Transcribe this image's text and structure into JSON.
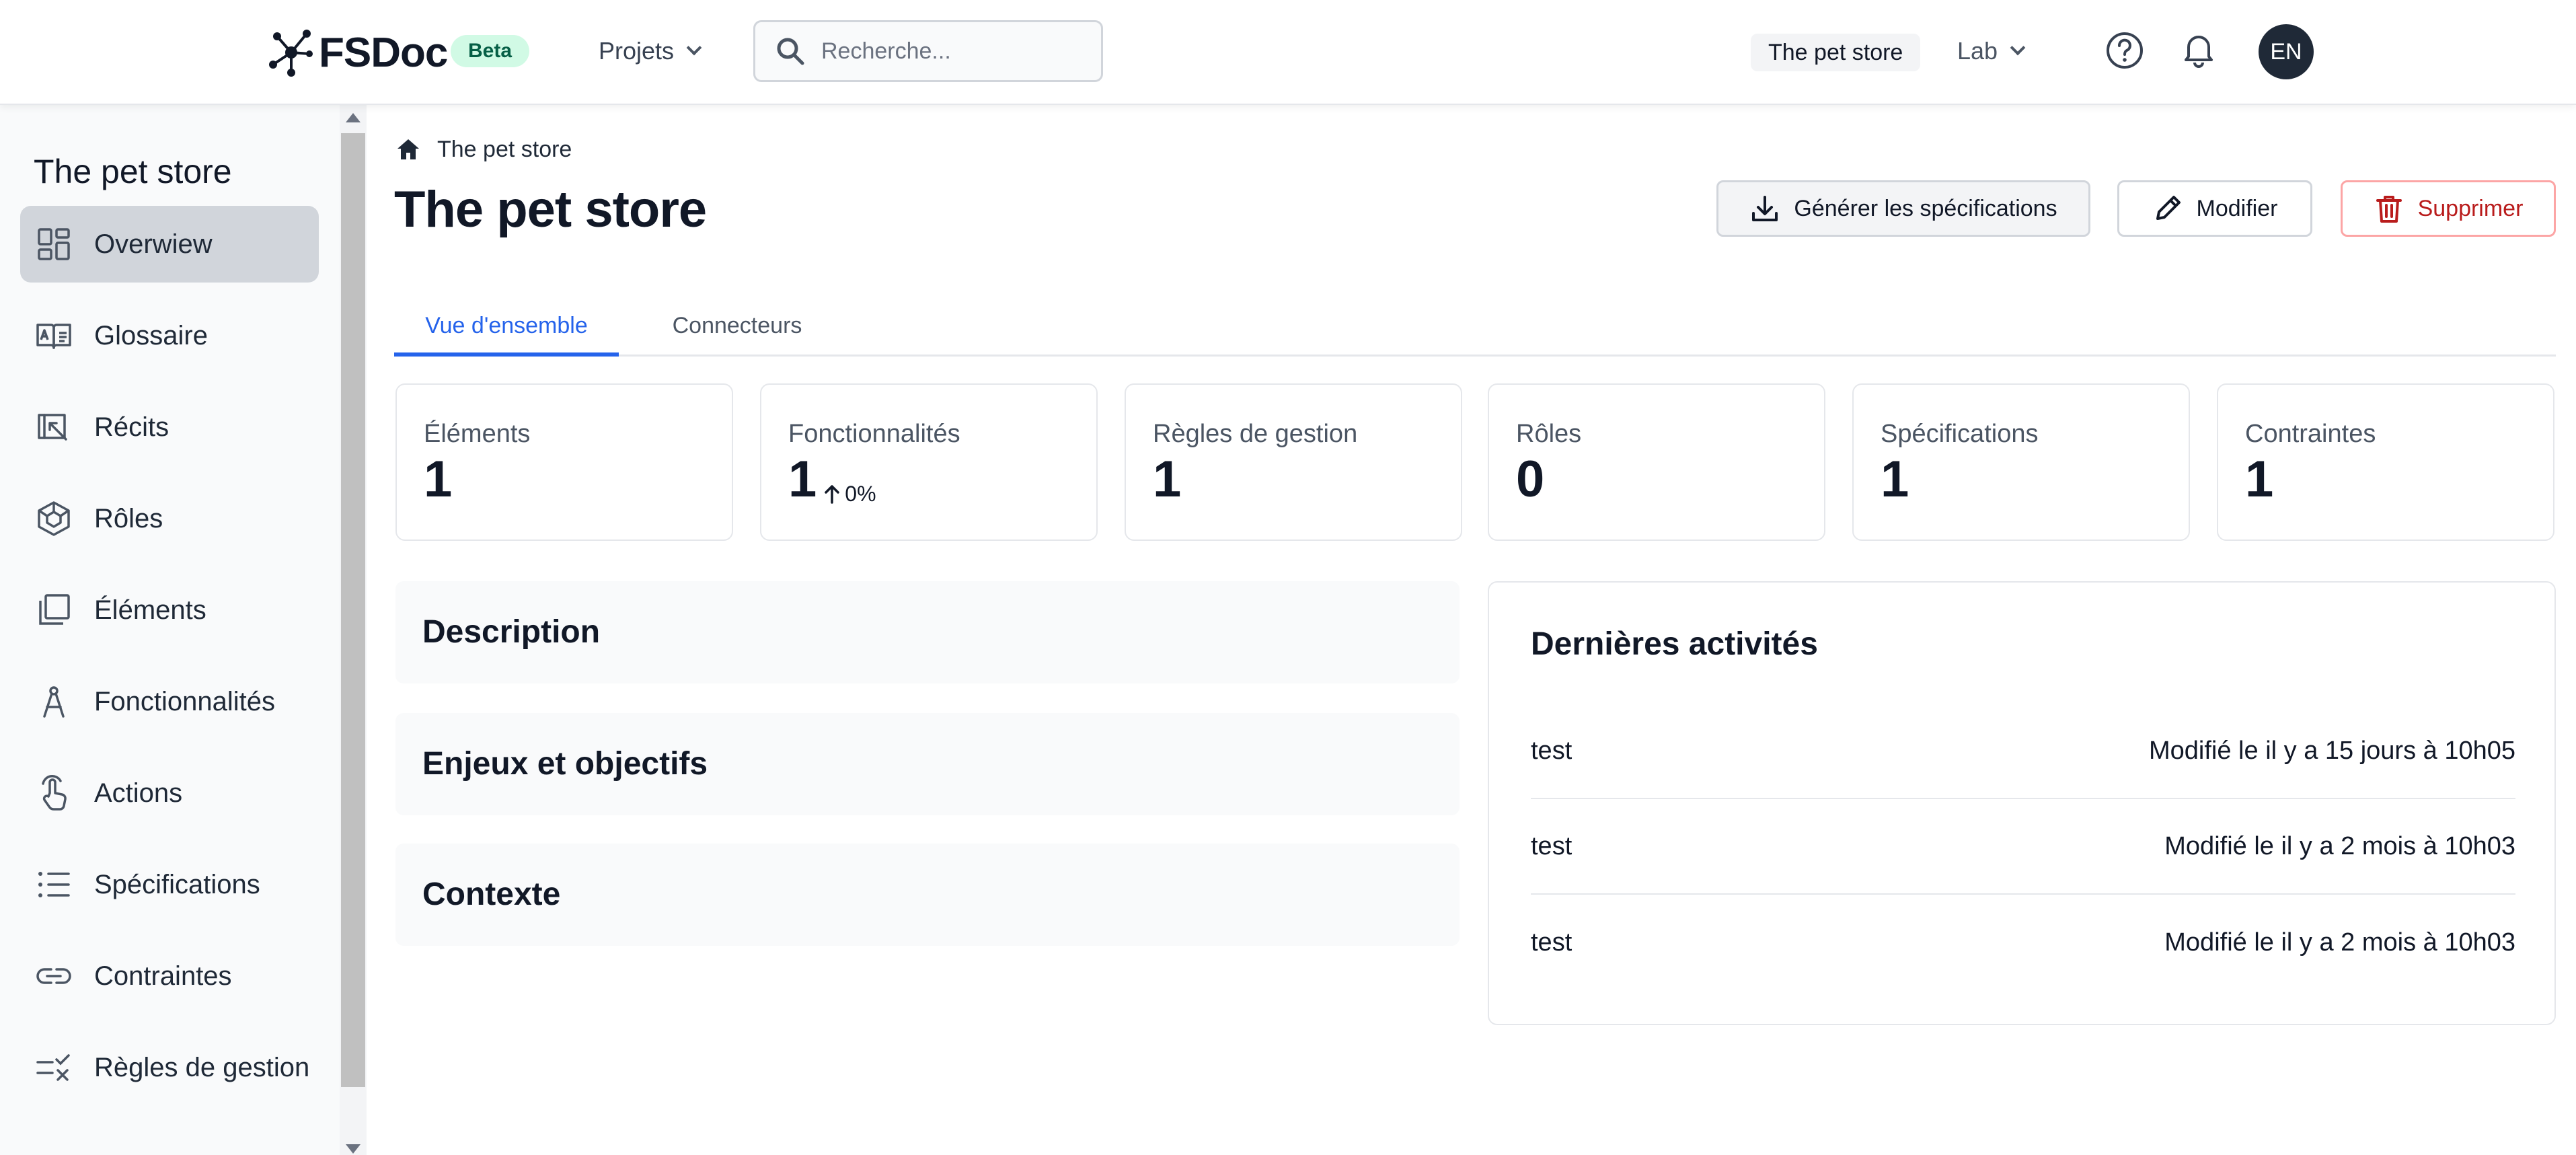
{
  "header": {
    "logo_text": "FSDoc",
    "beta_label": "Beta",
    "projects_label": "Projets",
    "search_placeholder": "Recherche...",
    "current_project": "The pet store",
    "workspace": "Lab",
    "avatar_initials": "EN"
  },
  "sidebar": {
    "title": "The pet store",
    "items": [
      {
        "label": "Overwiew",
        "icon": "dashboard-icon",
        "active": true
      },
      {
        "label": "Glossaire",
        "icon": "glossary-book-icon",
        "active": false
      },
      {
        "label": "Récits",
        "icon": "story-icon",
        "active": false
      },
      {
        "label": "Rôles",
        "icon": "role-cube-icon",
        "active": false
      },
      {
        "label": "Éléments",
        "icon": "elements-icon",
        "active": false
      },
      {
        "label": "Fonctionnalités",
        "icon": "compass-icon",
        "active": false
      },
      {
        "label": "Actions",
        "icon": "pointer-hand-icon",
        "active": false
      },
      {
        "label": "Spécifications",
        "icon": "list-icon",
        "active": false
      },
      {
        "label": "Contraintes",
        "icon": "link-icon",
        "active": false
      },
      {
        "label": "Règles de gestion",
        "icon": "rules-icon",
        "active": false
      }
    ]
  },
  "breadcrumb": {
    "label": "The pet store"
  },
  "page": {
    "title": "The pet store",
    "buttons": {
      "generate": "Générer les spécifications",
      "edit": "Modifier",
      "delete": "Supprimer"
    }
  },
  "tabs": [
    {
      "label": "Vue d'ensemble",
      "active": true
    },
    {
      "label": "Connecteurs",
      "active": false
    }
  ],
  "stats": [
    {
      "label": "Éléments",
      "value": "1"
    },
    {
      "label": "Fonctionnalités",
      "value": "1",
      "trend": "0%"
    },
    {
      "label": "Règles de gestion",
      "value": "1"
    },
    {
      "label": "Rôles",
      "value": "0"
    },
    {
      "label": "Spécifications",
      "value": "1"
    },
    {
      "label": "Contraintes",
      "value": "1"
    }
  ],
  "sections": [
    {
      "title": "Description"
    },
    {
      "title": "Enjeux et objectifs"
    },
    {
      "title": "Contexte"
    }
  ],
  "activity": {
    "title": "Dernières activités",
    "rows": [
      {
        "name": "test",
        "date": "Modifié le il y a 15 jours à 10h05"
      },
      {
        "name": "test",
        "date": "Modifié le il y a 2 mois à 10h03"
      },
      {
        "name": "test",
        "date": "Modifié le il y a 2 mois à 10h03"
      }
    ]
  },
  "colors": {
    "accent": "#2563eb",
    "danger": "#b91c1c",
    "beta_bg": "#d1fae5"
  }
}
